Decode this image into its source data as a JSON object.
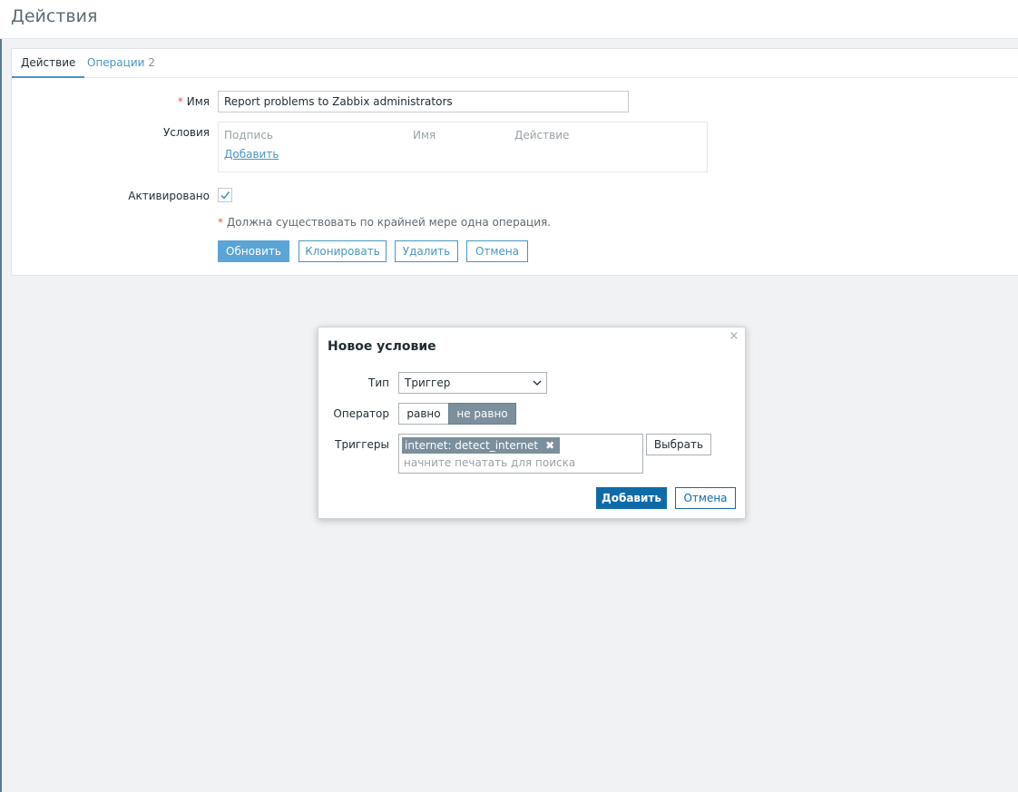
{
  "page": {
    "title": "Действия"
  },
  "tabs": [
    {
      "label": "Действие"
    },
    {
      "label": "Операции",
      "count": "2"
    }
  ],
  "form": {
    "name_required_marker": "*",
    "name_label": "Имя",
    "name_value": "Report problems to Zabbix administrators",
    "conditions_label": "Условия",
    "conditions_columns": [
      "Подпись",
      "Имя",
      "Действие"
    ],
    "conditions_add_link": "Добавить",
    "enabled_label": "Активировано",
    "enabled_checked": true,
    "note_marker": "*",
    "note_text": "Должна существовать по крайней мере одна операция.",
    "buttons": {
      "update": "Обновить",
      "clone": "Клонировать",
      "delete": "Удалить",
      "cancel": "Отмена"
    }
  },
  "dialog": {
    "title": "Новое условие",
    "close_icon": "×",
    "type_label": "Тип",
    "type_value": "Триггер",
    "operator_label": "Оператор",
    "operator_options": [
      "равно",
      "не равно"
    ],
    "operator_selected": "не равно",
    "triggers_label": "Триггеры",
    "trigger_chips": [
      "internet: detect_internet"
    ],
    "chip_remove_icon": "✖",
    "search_placeholder": "начните печатать для поиска",
    "select_button": "Выбрать",
    "add_button": "Добавить",
    "cancel_button": "Отмена"
  },
  "colors": {
    "accent": "#4796c4",
    "primary_button": "#5ba4d6",
    "dialog_primary": "#0f6ba7",
    "required": "#e45959",
    "selected_segment": "#7b8f9c"
  }
}
